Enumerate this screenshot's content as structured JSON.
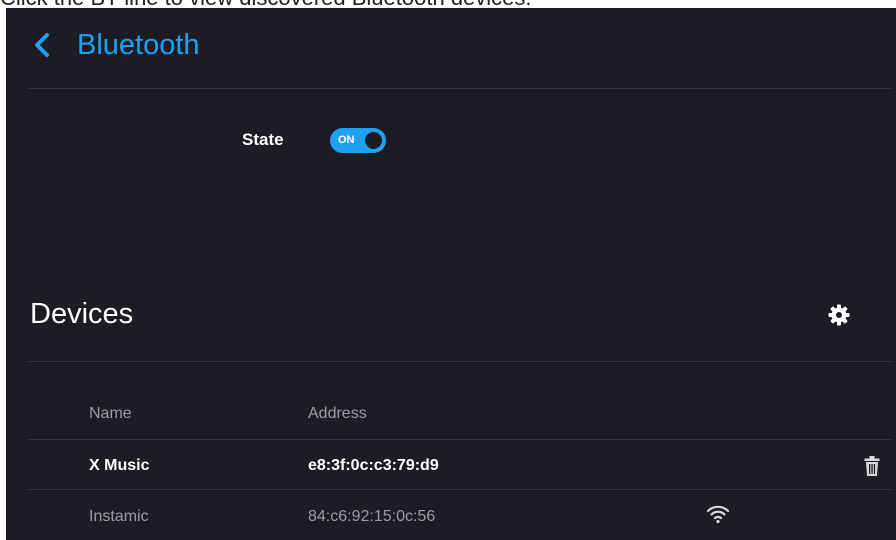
{
  "caption": {
    "text": "Click the BT line to view discovered Bluetooth devices."
  },
  "header": {
    "title": "Bluetooth",
    "back_icon": "chevron-left-icon"
  },
  "state": {
    "label": "State",
    "toggle_text": "ON",
    "on": true
  },
  "devices": {
    "title": "Devices",
    "settings_icon": "gear-icon",
    "columns": {
      "name": "Name",
      "address": "Address"
    },
    "rows": [
      {
        "name": "X Music",
        "address": "e8:3f:0c:c3:79:d9",
        "action_icon": "trash-icon"
      },
      {
        "name": "Instamic",
        "address": "84:c6:92:15:0c:56",
        "status_icon": "wifi-signal-icon"
      }
    ]
  },
  "colors": {
    "accent": "#1da1f2",
    "background": "#1b1c24",
    "divider": "#33343f",
    "muted": "#9a9ba3"
  }
}
